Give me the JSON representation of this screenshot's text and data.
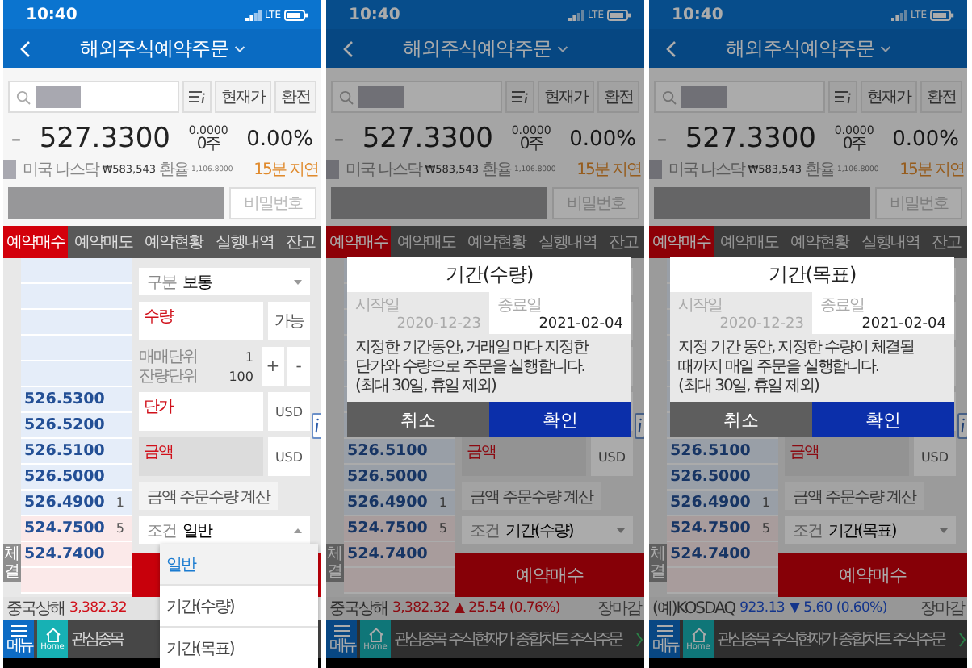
{
  "screens": [
    {
      "status_bar": {
        "time": "10:40",
        "network": "LTE"
      },
      "header": {
        "title": "해외주식예약주문"
      },
      "search": {
        "buttons": [
          "현재가",
          "환전"
        ]
      },
      "quote": {
        "sign": "–",
        "price": "527.3300",
        "change": "0.0000",
        "volume": "0주",
        "rate": "0.00%"
      },
      "info": {
        "market": "미국 나스닥",
        "amount": "₩583,543",
        "rate_label": "환율",
        "rate": "1,106.8000",
        "delay": "15분 지연"
      },
      "account": {
        "password_placeholder": "비밀번호"
      },
      "tabs": [
        {
          "label": "예약매수",
          "selected": true
        },
        {
          "label": "예약매도",
          "selected": false
        },
        {
          "label": "예약현황",
          "selected": false
        },
        {
          "label": "실행내역",
          "selected": false
        },
        {
          "label": "잔고",
          "selected": false
        }
      ],
      "orderbook": {
        "side_tab": "체결",
        "rows": [
          {
            "kind": "ask"
          },
          {
            "kind": "ask"
          },
          {
            "kind": "ask"
          },
          {
            "kind": "ask"
          },
          {
            "kind": "ask"
          },
          {
            "kind": "ask",
            "price": "526.5300"
          },
          {
            "kind": "ask",
            "price": "526.5200"
          },
          {
            "kind": "ask",
            "price": "526.5100"
          },
          {
            "kind": "ask",
            "price": "526.5000"
          },
          {
            "kind": "ask",
            "price": "526.4900",
            "qty": "1"
          },
          {
            "kind": "bid",
            "price": "524.7500",
            "qty": "5"
          },
          {
            "kind": "bid",
            "price": "524.7400"
          },
          {
            "kind": "bid"
          }
        ]
      },
      "form": {
        "type_label": "구분",
        "type_value": "보통",
        "qty_label": "수량",
        "available": "가능",
        "units": [
          {
            "label": "매매단위",
            "value": "1"
          },
          {
            "label": "잔량단위",
            "value": "100"
          }
        ],
        "steps": [
          "+",
          "-"
        ],
        "price_label": "단가",
        "price_currency": "USD",
        "amount_label": "금액",
        "amount_currency": "USD",
        "calc": "금액 주문수량 계산",
        "cond_label": "조건",
        "cond_value": "일반",
        "expanded": true
      },
      "dropdown": {
        "items": [
          {
            "label": "일반",
            "selected": true
          },
          {
            "label": "기간(수량)",
            "selected": false
          },
          {
            "label": "기간(목표)",
            "selected": false
          }
        ]
      },
      "ticker": {
        "name": "중국상해",
        "value": "3,382.32",
        "kind": "up"
      },
      "nav": {
        "menu": "메뉴",
        "home": "Home",
        "items": [
          "관심종목"
        ]
      }
    },
    {
      "status_bar": {
        "time": "10:40",
        "network": "LTE"
      },
      "header": {
        "title": "해외주식예약주문"
      },
      "search": {
        "buttons": [
          "현재가",
          "환전"
        ]
      },
      "quote": {
        "sign": "–",
        "price": "527.3300",
        "change": "0.0000",
        "volume": "0주",
        "rate": "0.00%"
      },
      "info": {
        "market": "미국 나스닥",
        "amount": "₩583,543",
        "rate_label": "환율",
        "rate": "1,106.8000",
        "delay": "15분 지연"
      },
      "account": {
        "password_placeholder": "비밀번호"
      },
      "tabs": [
        {
          "label": "예약매수",
          "selected": true
        },
        {
          "label": "예약매도",
          "selected": false
        },
        {
          "label": "예약현황",
          "selected": false
        },
        {
          "label": "실행내역",
          "selected": false
        },
        {
          "label": "잔고",
          "selected": false
        }
      ],
      "orderbook": {
        "side_tab": "체결",
        "rows": [
          {
            "kind": "ask"
          },
          {
            "kind": "ask"
          },
          {
            "kind": "ask"
          },
          {
            "kind": "ask"
          },
          {
            "kind": "ask"
          },
          {
            "kind": "ask"
          },
          {
            "kind": "ask"
          },
          {
            "kind": "ask",
            "price": "526.5100"
          },
          {
            "kind": "ask",
            "price": "526.5000"
          },
          {
            "kind": "ask",
            "price": "526.4900",
            "qty": "1"
          },
          {
            "kind": "bid",
            "price": "524.7500",
            "qty": "5"
          },
          {
            "kind": "bid",
            "price": "524.7400"
          },
          {
            "kind": "bid"
          }
        ]
      },
      "form": {
        "amount_label": "금액",
        "amount_currency": "USD",
        "calc": "금액 주문수량 계산",
        "cond_label": "조건",
        "cond_value": "기간(수량)",
        "expanded": false,
        "submit": "예약매수"
      },
      "dialog": {
        "title": "기간(수량)",
        "dates": [
          {
            "label": "시작일",
            "value": "2020-12-23",
            "disabled": true
          },
          {
            "label": "종료일",
            "value": "2021-02-04",
            "disabled": false
          }
        ],
        "description": "지정한 기간동안, 거래일 마다 지정한\n단가와 수량으로 주문을 실행합니다.\n(최대 30일, 휴일 제외)",
        "cancel": "취소",
        "confirm": "확인"
      },
      "ticker": {
        "name": "중국상해",
        "value": "3,382.32",
        "change": "▲ 25.54 (0.76%)",
        "kind": "up",
        "status": "장마감"
      },
      "nav": {
        "menu": "메뉴",
        "home": "Home",
        "items": [
          "관심종목",
          "주식현재가",
          "종합차트",
          "주식주문"
        ],
        "more": true
      }
    },
    {
      "status_bar": {
        "time": "10:40",
        "network": "LTE"
      },
      "header": {
        "title": "해외주식예약주문"
      },
      "search": {
        "buttons": [
          "현재가",
          "환전"
        ]
      },
      "quote": {
        "sign": "–",
        "price": "527.3300",
        "change": "0.0000",
        "volume": "0주",
        "rate": "0.00%"
      },
      "info": {
        "market": "미국 나스닥",
        "amount": "₩583,543",
        "rate_label": "환율",
        "rate": "1,106.8000",
        "delay": "15분 지연"
      },
      "account": {
        "password_placeholder": "비밀번호"
      },
      "tabs": [
        {
          "label": "예약매수",
          "selected": true
        },
        {
          "label": "예약매도",
          "selected": false
        },
        {
          "label": "예약현황",
          "selected": false
        },
        {
          "label": "실행내역",
          "selected": false
        },
        {
          "label": "잔고",
          "selected": false
        }
      ],
      "orderbook": {
        "side_tab": "체결",
        "rows": [
          {
            "kind": "ask"
          },
          {
            "kind": "ask"
          },
          {
            "kind": "ask"
          },
          {
            "kind": "ask"
          },
          {
            "kind": "ask"
          },
          {
            "kind": "ask"
          },
          {
            "kind": "ask"
          },
          {
            "kind": "ask",
            "price": "526.5100"
          },
          {
            "kind": "ask",
            "price": "526.5000"
          },
          {
            "kind": "ask",
            "price": "526.4900",
            "qty": "1"
          },
          {
            "kind": "bid",
            "price": "524.7500",
            "qty": "5"
          },
          {
            "kind": "bid",
            "price": "524.7400"
          },
          {
            "kind": "bid"
          }
        ]
      },
      "form": {
        "amount_label": "금액",
        "amount_currency": "USD",
        "calc": "금액 주문수량 계산",
        "cond_label": "조건",
        "cond_value": "기간(목표)",
        "expanded": false,
        "submit": "예약매수"
      },
      "dialog": {
        "title": "기간(목표)",
        "dates": [
          {
            "label": "시작일",
            "value": "2020-12-23",
            "disabled": true
          },
          {
            "label": "종료일",
            "value": "2021-02-04",
            "disabled": false
          }
        ],
        "description": "지정 기간 동안, 지정한 수량이 체결될\n때까지 매일 주문을 실행합니다.\n(최대 30일, 휴일 제외)",
        "cancel": "취소",
        "confirm": "확인"
      },
      "ticker": {
        "name": "(예)KOSDAQ",
        "value": "923.13",
        "change": "▼ 5.60 (0.60%)",
        "kind": "down",
        "status": "장마감"
      },
      "nav": {
        "menu": "메뉴",
        "home": "Home",
        "items": [
          "관심종목",
          "주식현재가",
          "종합차트",
          "주식주문"
        ],
        "more": true
      }
    }
  ]
}
